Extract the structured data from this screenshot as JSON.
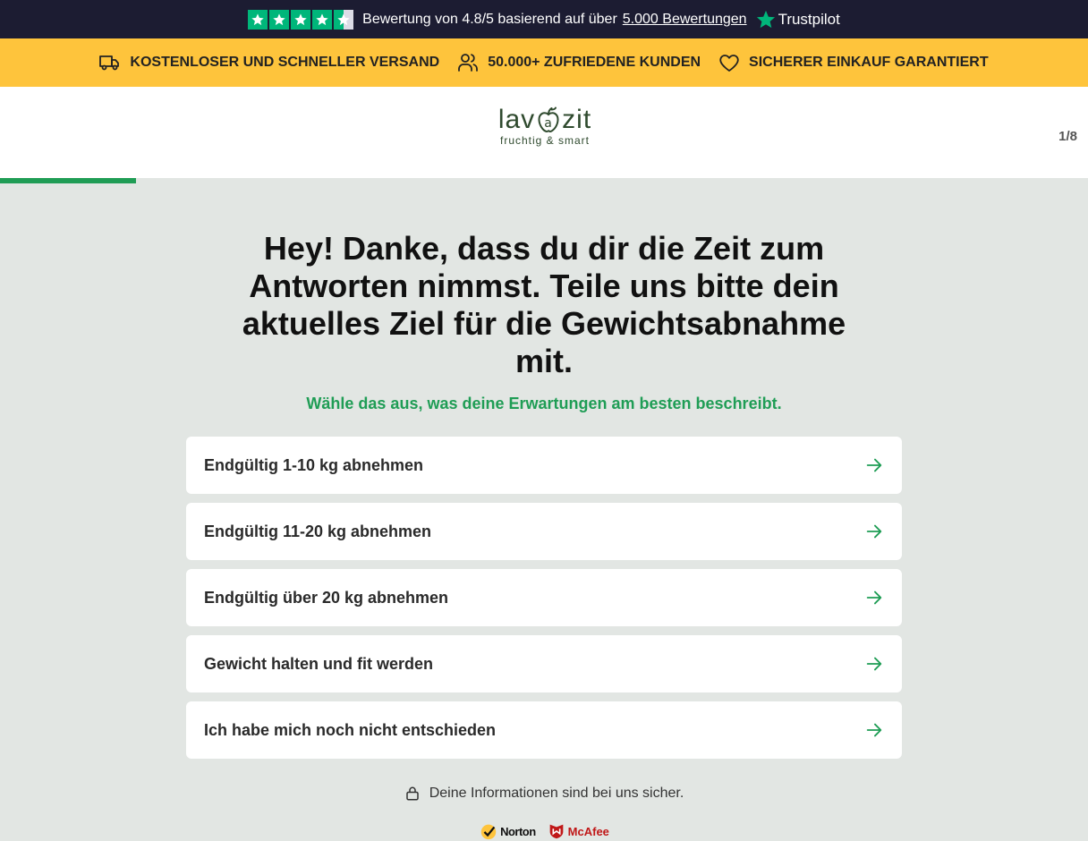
{
  "trustbar": {
    "rating_text": "Bewertung von 4.8/5 basierend auf über",
    "reviews_link": "5.000 Bewertungen",
    "brand": "Trustpilot",
    "star_color": "#00b67a"
  },
  "benefits": [
    {
      "icon": "truck-icon",
      "label": "KOSTENLOSER UND SCHNELLER VERSAND"
    },
    {
      "icon": "users-icon",
      "label": "50.000+ ZUFRIEDENE KUNDEN"
    },
    {
      "icon": "heart-icon",
      "label": "SICHERER EINKAUF GARANTIERT"
    }
  ],
  "header": {
    "logo_left": "lav",
    "logo_right": "zit",
    "logo_tagline": "fruchtig & smart",
    "step_label": "1/8",
    "progress": 0.125
  },
  "quiz": {
    "title": "Hey! Danke, dass du dir die Zeit zum Antworten nimmst. Teile uns bitte dein aktuelles Ziel für die Gewichtsabnahme mit.",
    "subtitle": "Wähle das aus, was deine Erwartungen am besten beschreibt.",
    "options": [
      "Endgültig 1-10 kg abnehmen",
      "Endgültig 11-20 kg abnehmen",
      "Endgültig über 20 kg abnehmen",
      "Gewicht halten und fit werden",
      "Ich habe mich noch nicht entschieden"
    ]
  },
  "footer": {
    "secure_text": "Deine Informationen sind bei uns sicher.",
    "badge_norton": "Norton",
    "badge_mcafee": "McAfee"
  },
  "colors": {
    "accent_green": "#1f9d55",
    "yellow_bar": "#fec43c",
    "dark_bar": "#1c1c32"
  }
}
